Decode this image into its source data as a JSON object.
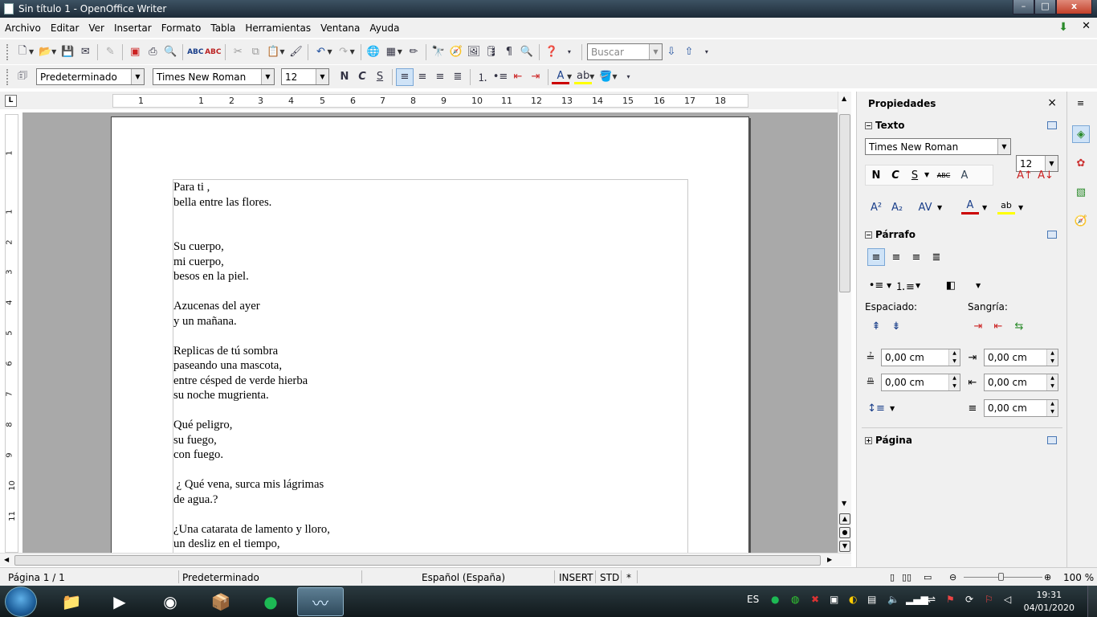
{
  "window": {
    "title": "Sin título 1 - OpenOffice Writer",
    "min": "–",
    "max": "□",
    "close": "x"
  },
  "menu": [
    "Archivo",
    "Editar",
    "Ver",
    "Insertar",
    "Formato",
    "Tabla",
    "Herramientas",
    "Ventana",
    "Ayuda"
  ],
  "toolbar": {
    "search_placeholder": "Buscar"
  },
  "format": {
    "style": "Predeterminado",
    "font": "Times New Roman",
    "size": "12",
    "bold": "N",
    "italic": "C",
    "underline": "S"
  },
  "ruler": {
    "corner": "L",
    "h_ticks": [
      "1",
      "1",
      "2",
      "3",
      "4",
      "5",
      "6",
      "7",
      "8",
      "9",
      "10",
      "11",
      "12",
      "13",
      "14",
      "15",
      "16",
      "17",
      "18"
    ],
    "v_ticks": [
      "1",
      "1",
      "2",
      "3",
      "4",
      "5",
      "6",
      "7",
      "8",
      "9",
      "10",
      "11"
    ]
  },
  "document": {
    "text": "Para ti ,\nbella entre las flores.\n\n\nSu cuerpo,\nmi cuerpo,\nbesos en la piel.\n\nAzucenas del ayer\ny un mañana.\n\nReplicas de tú sombra\npaseando una mascota,\nentre césped de verde hierba\nsu noche mugrienta.\n\nQué peligro,\nsu fuego,\ncon fuego.\n\n ¿ Qué vena, surca mis lágrimas\nde agua.?\n\n¿Una catarata de lamento y lloro,\nun desliz en el tiempo,"
  },
  "sidebar": {
    "title": "Propiedades",
    "close": "×",
    "text_section": "Texto",
    "font": "Times New Roman",
    "size": "12",
    "para_section": "Párrafo",
    "spacing_label": "Espaciado:",
    "indent_label": "Sangría:",
    "above": "0,00 cm",
    "below": "0,00 cm",
    "before_text": "0,00 cm",
    "after_text": "0,00 cm",
    "first_line": "0,00 cm",
    "page_section": "Página"
  },
  "status": {
    "page": "Página 1 / 1",
    "style": "Predeterminado",
    "language": "Español (España)",
    "mode": "INSERT",
    "selection": "STD",
    "modified": "*",
    "zoom": "100 %"
  },
  "taskbar": {
    "lang": "ES",
    "time": "19:31",
    "date": "04/01/2020"
  }
}
